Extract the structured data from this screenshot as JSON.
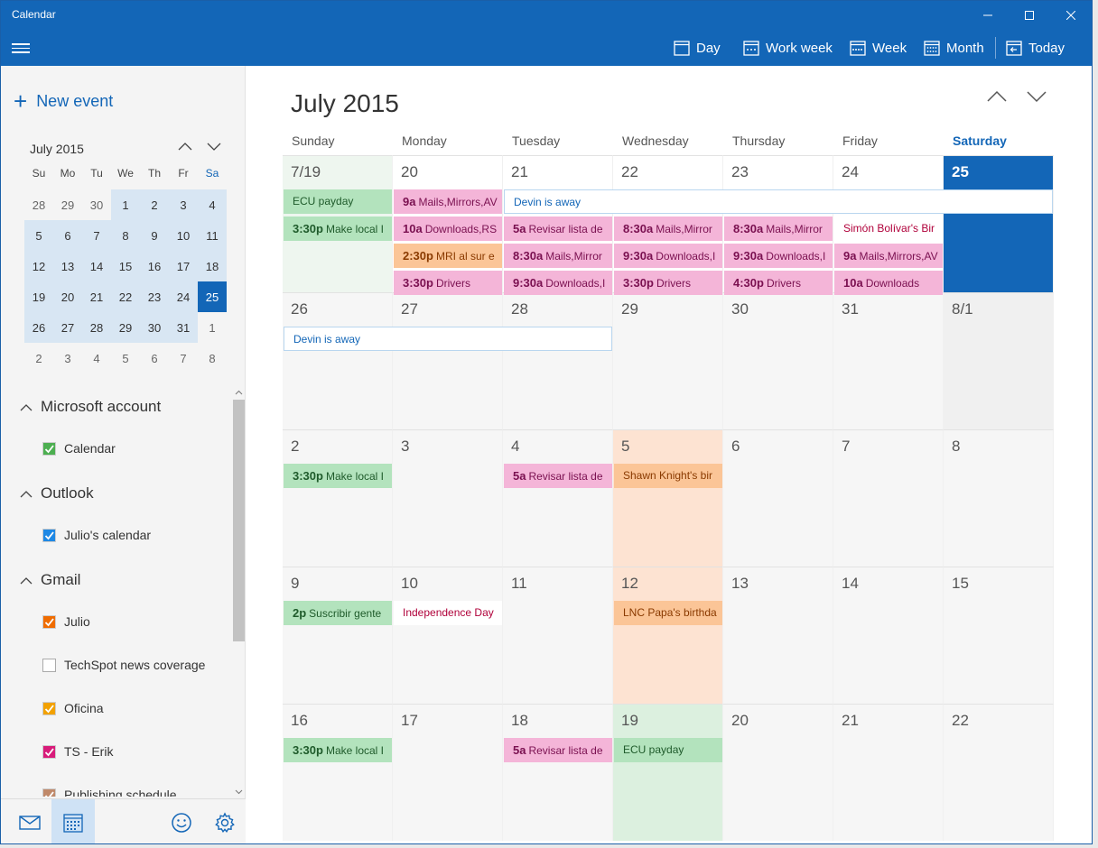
{
  "window": {
    "title": "Calendar"
  },
  "toolbar": {
    "views": [
      {
        "label": "Day"
      },
      {
        "label": "Work week"
      },
      {
        "label": "Week"
      },
      {
        "label": "Month"
      },
      {
        "label": "Today"
      }
    ]
  },
  "sidebar": {
    "new_event": "New event",
    "mini": {
      "title": "July 2015",
      "weekdays": [
        "Su",
        "Mo",
        "Tu",
        "We",
        "Th",
        "Fr",
        "Sa"
      ],
      "weeks": [
        [
          "28",
          "29",
          "30",
          "1",
          "2",
          "3",
          "4"
        ],
        [
          "5",
          "6",
          "7",
          "8",
          "9",
          "10",
          "11"
        ],
        [
          "12",
          "13",
          "14",
          "15",
          "16",
          "17",
          "18"
        ],
        [
          "19",
          "20",
          "21",
          "22",
          "23",
          "24",
          "25"
        ],
        [
          "26",
          "27",
          "28",
          "29",
          "30",
          "31",
          "1"
        ],
        [
          "2",
          "3",
          "4",
          "5",
          "6",
          "7",
          "8"
        ]
      ],
      "today": "25"
    },
    "accounts": [
      {
        "name": "Microsoft account",
        "calendars": [
          {
            "label": "Calendar",
            "color": "#4caf50",
            "checked": true
          }
        ]
      },
      {
        "name": "Outlook",
        "calendars": [
          {
            "label": "Julio's calendar",
            "color": "#1e88e5",
            "checked": true
          }
        ]
      },
      {
        "name": "Gmail",
        "calendars": [
          {
            "label": "Julio",
            "color": "#ef6c00",
            "checked": true
          },
          {
            "label": "TechSpot news coverage",
            "color": "#ffffff",
            "checked": false
          },
          {
            "label": "Oficina",
            "color": "#f2a100",
            "checked": true
          },
          {
            "label": "TS - Erik",
            "color": "#d81b7a",
            "checked": true
          },
          {
            "label": "Publishing schedule",
            "color": "#c0896a",
            "checked": true
          }
        ]
      }
    ]
  },
  "main": {
    "title": "July 2015",
    "days": [
      "Sunday",
      "Monday",
      "Tuesday",
      "Wednesday",
      "Thursday",
      "Friday",
      "Saturday"
    ],
    "weeks": [
      [
        "7/19",
        "20",
        "21",
        "22",
        "23",
        "24",
        "25"
      ],
      [
        "26",
        "27",
        "28",
        "29",
        "30",
        "31",
        "8/1"
      ],
      [
        "2",
        "3",
        "4",
        "5",
        "6",
        "7",
        "8"
      ],
      [
        "9",
        "10",
        "11",
        "12",
        "13",
        "14",
        "15"
      ],
      [
        "16",
        "17",
        "18",
        "19",
        "20",
        "21",
        "22"
      ]
    ],
    "events": [
      {
        "week": 0,
        "day": 0,
        "slot": 0,
        "time": "",
        "title": "ECU payday",
        "color": "green"
      },
      {
        "week": 0,
        "day": 0,
        "slot": 1,
        "time": "3:30p",
        "title": "Make local I",
        "color": "green"
      },
      {
        "week": 0,
        "day": 1,
        "slot": 0,
        "time": "9a",
        "title": "Mails,Mirrors,AV",
        "color": "pink"
      },
      {
        "week": 0,
        "day": 1,
        "slot": 1,
        "time": "10a",
        "title": "Downloads,RS",
        "color": "pink"
      },
      {
        "week": 0,
        "day": 1,
        "slot": 2,
        "time": "2:30p",
        "title": "MRI al sur e",
        "color": "orange"
      },
      {
        "week": 0,
        "day": 1,
        "slot": 3,
        "time": "3:30p",
        "title": "Drivers",
        "color": "pink"
      },
      {
        "week": 0,
        "day": 2,
        "slot": 0,
        "span": 5,
        "time": "",
        "title": "Devin is away",
        "color": "blue"
      },
      {
        "week": 0,
        "day": 2,
        "slot": 1,
        "time": "5a",
        "title": "Revisar lista de",
        "color": "pink"
      },
      {
        "week": 0,
        "day": 2,
        "slot": 2,
        "time": "8:30a",
        "title": "Mails,Mirror",
        "color": "pink"
      },
      {
        "week": 0,
        "day": 2,
        "slot": 3,
        "time": "9:30a",
        "title": "Downloads,I",
        "color": "pink"
      },
      {
        "week": 0,
        "day": 3,
        "slot": 1,
        "time": "8:30a",
        "title": "Mails,Mirror",
        "color": "pink"
      },
      {
        "week": 0,
        "day": 3,
        "slot": 2,
        "time": "9:30a",
        "title": "Downloads,I",
        "color": "pink"
      },
      {
        "week": 0,
        "day": 3,
        "slot": 3,
        "time": "3:30p",
        "title": "Drivers",
        "color": "pink"
      },
      {
        "week": 0,
        "day": 4,
        "slot": 1,
        "time": "8:30a",
        "title": "Mails,Mirror",
        "color": "pink"
      },
      {
        "week": 0,
        "day": 4,
        "slot": 2,
        "time": "9:30a",
        "title": "Downloads,I",
        "color": "pink"
      },
      {
        "week": 0,
        "day": 4,
        "slot": 3,
        "time": "4:30p",
        "title": "Drivers",
        "color": "pink"
      },
      {
        "week": 0,
        "day": 5,
        "slot": 1,
        "time": "",
        "title": "Simón Bolívar's Bir",
        "color": "white"
      },
      {
        "week": 0,
        "day": 5,
        "slot": 2,
        "time": "9a",
        "title": "Mails,Mirrors,AV",
        "color": "pink"
      },
      {
        "week": 0,
        "day": 5,
        "slot": 3,
        "time": "10a",
        "title": "Downloads",
        "color": "pink"
      },
      {
        "week": 1,
        "day": 0,
        "slot": 0,
        "span": 3,
        "time": "",
        "title": "Devin is away",
        "color": "blue"
      },
      {
        "week": 2,
        "day": 0,
        "slot": 0,
        "time": "3:30p",
        "title": "Make local I",
        "color": "green"
      },
      {
        "week": 2,
        "day": 2,
        "slot": 0,
        "time": "5a",
        "title": "Revisar lista de",
        "color": "pink"
      },
      {
        "week": 2,
        "day": 3,
        "slot": 0,
        "time": "",
        "title": "Shawn Knight's bir",
        "color": "orange"
      },
      {
        "week": 3,
        "day": 0,
        "slot": 0,
        "time": "2p",
        "title": "Suscribir gente",
        "color": "green"
      },
      {
        "week": 3,
        "day": 1,
        "slot": 0,
        "time": "",
        "title": "Independence Day",
        "color": "white"
      },
      {
        "week": 3,
        "day": 3,
        "slot": 0,
        "time": "",
        "title": "LNC Papa's birthda",
        "color": "orange"
      },
      {
        "week": 4,
        "day": 0,
        "slot": 0,
        "time": "3:30p",
        "title": "Make local I",
        "color": "green"
      },
      {
        "week": 4,
        "day": 2,
        "slot": 0,
        "time": "5a",
        "title": "Revisar lista de",
        "color": "pink"
      },
      {
        "week": 4,
        "day": 3,
        "slot": 0,
        "time": "",
        "title": "ECU payday",
        "color": "green"
      }
    ]
  }
}
